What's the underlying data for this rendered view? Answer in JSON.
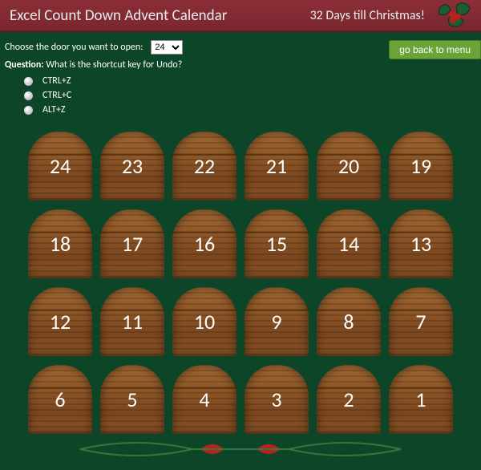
{
  "header": {
    "title": "Excel Count Down Advent Calendar",
    "countdown": "32 Days till Christmas!"
  },
  "chooser": {
    "label": "Choose the door you want to open:",
    "selected": "24"
  },
  "menu_button": "go back to menu",
  "question": {
    "label": "Question:",
    "text": "What is the shortcut key for Undo?",
    "answers": [
      "CTRL+Z",
      "CTRL+C",
      "ALT+Z"
    ]
  },
  "doors": [
    24,
    23,
    22,
    21,
    20,
    19,
    18,
    17,
    16,
    15,
    14,
    13,
    12,
    11,
    10,
    9,
    8,
    7,
    6,
    5,
    4,
    3,
    2,
    1
  ],
  "colors": {
    "header_bg": "#7a2730",
    "page_bg": "#0d4529",
    "door_wood": "#8b5426",
    "menu_btn": "#6aa338"
  }
}
